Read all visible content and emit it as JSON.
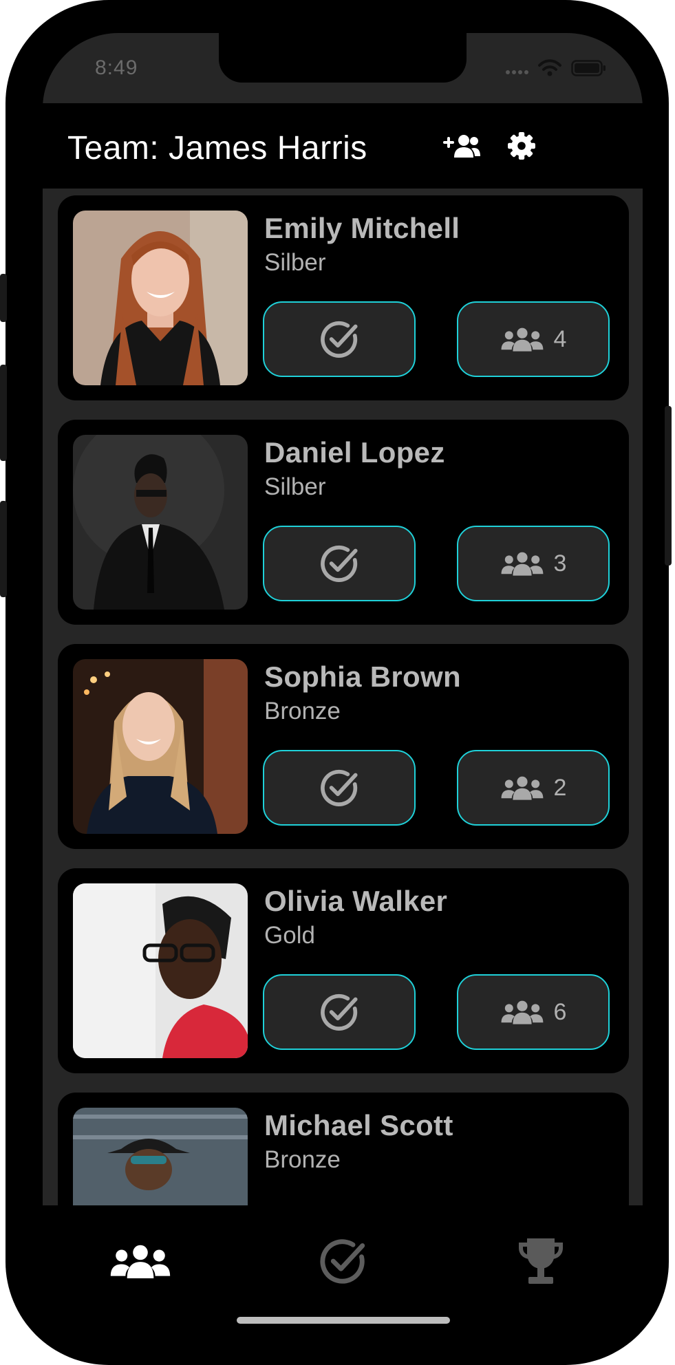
{
  "status_bar": {
    "time": "8:49"
  },
  "header": {
    "title": "Team: James Harris",
    "add_member_icon": "add-user-icon",
    "settings_icon": "gear-icon"
  },
  "members": [
    {
      "name": "Emily Mitchell",
      "tier": "Silber",
      "team_count": "4",
      "photo": "woman-red-hair-portrait"
    },
    {
      "name": "Daniel Lopez",
      "tier": "Silber",
      "team_count": "3",
      "photo": "man-dark-suit-portrait"
    },
    {
      "name": "Sophia Brown",
      "tier": "Bronze",
      "team_count": "2",
      "photo": "woman-blonde-portrait"
    },
    {
      "name": "Olivia Walker",
      "tier": "Gold",
      "team_count": "6",
      "photo": "woman-glasses-red-top-portrait"
    },
    {
      "name": "Michael Scott",
      "tier": "Bronze",
      "team_count": "",
      "photo": "man-hat-sunglasses-portrait"
    }
  ],
  "tab_bar": {
    "tabs": [
      {
        "icon": "team-icon",
        "active": true
      },
      {
        "icon": "check-circle-icon",
        "active": false
      },
      {
        "icon": "trophy-icon",
        "active": false
      }
    ]
  },
  "colors": {
    "accent": "#1fd1d9",
    "card_bg": "#000000",
    "list_bg": "#262626",
    "button_bg": "#262626",
    "text_muted": "#b9b9b9"
  }
}
